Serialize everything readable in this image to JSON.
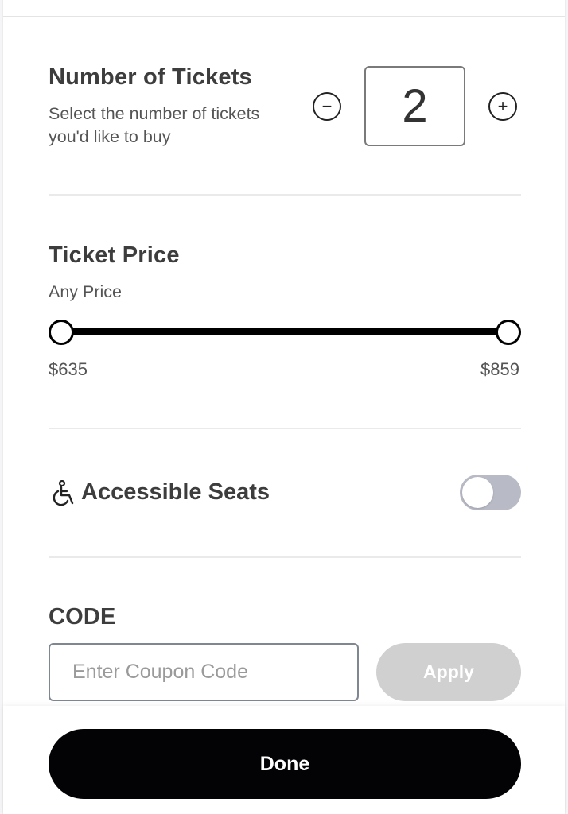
{
  "tickets": {
    "title": "Number of Tickets",
    "description": "Select the number of tickets you'd like to buy",
    "quantity": "2",
    "minus_symbol": "−",
    "plus_symbol": "+"
  },
  "price": {
    "title": "Ticket Price",
    "subtitle": "Any Price",
    "min_label": "$635",
    "max_label": "$859",
    "range_value_fraction": [
      0,
      1
    ]
  },
  "accessible": {
    "icon": "wheelchair-icon",
    "title": "Accessible Seats",
    "toggle_on": false,
    "toggle_color": "#b8bac6"
  },
  "code": {
    "title": "CODE",
    "placeholder": "Enter Coupon Code",
    "value": "",
    "apply_label": "Apply"
  },
  "footer": {
    "done_label": "Done",
    "done_color": "#030306"
  }
}
